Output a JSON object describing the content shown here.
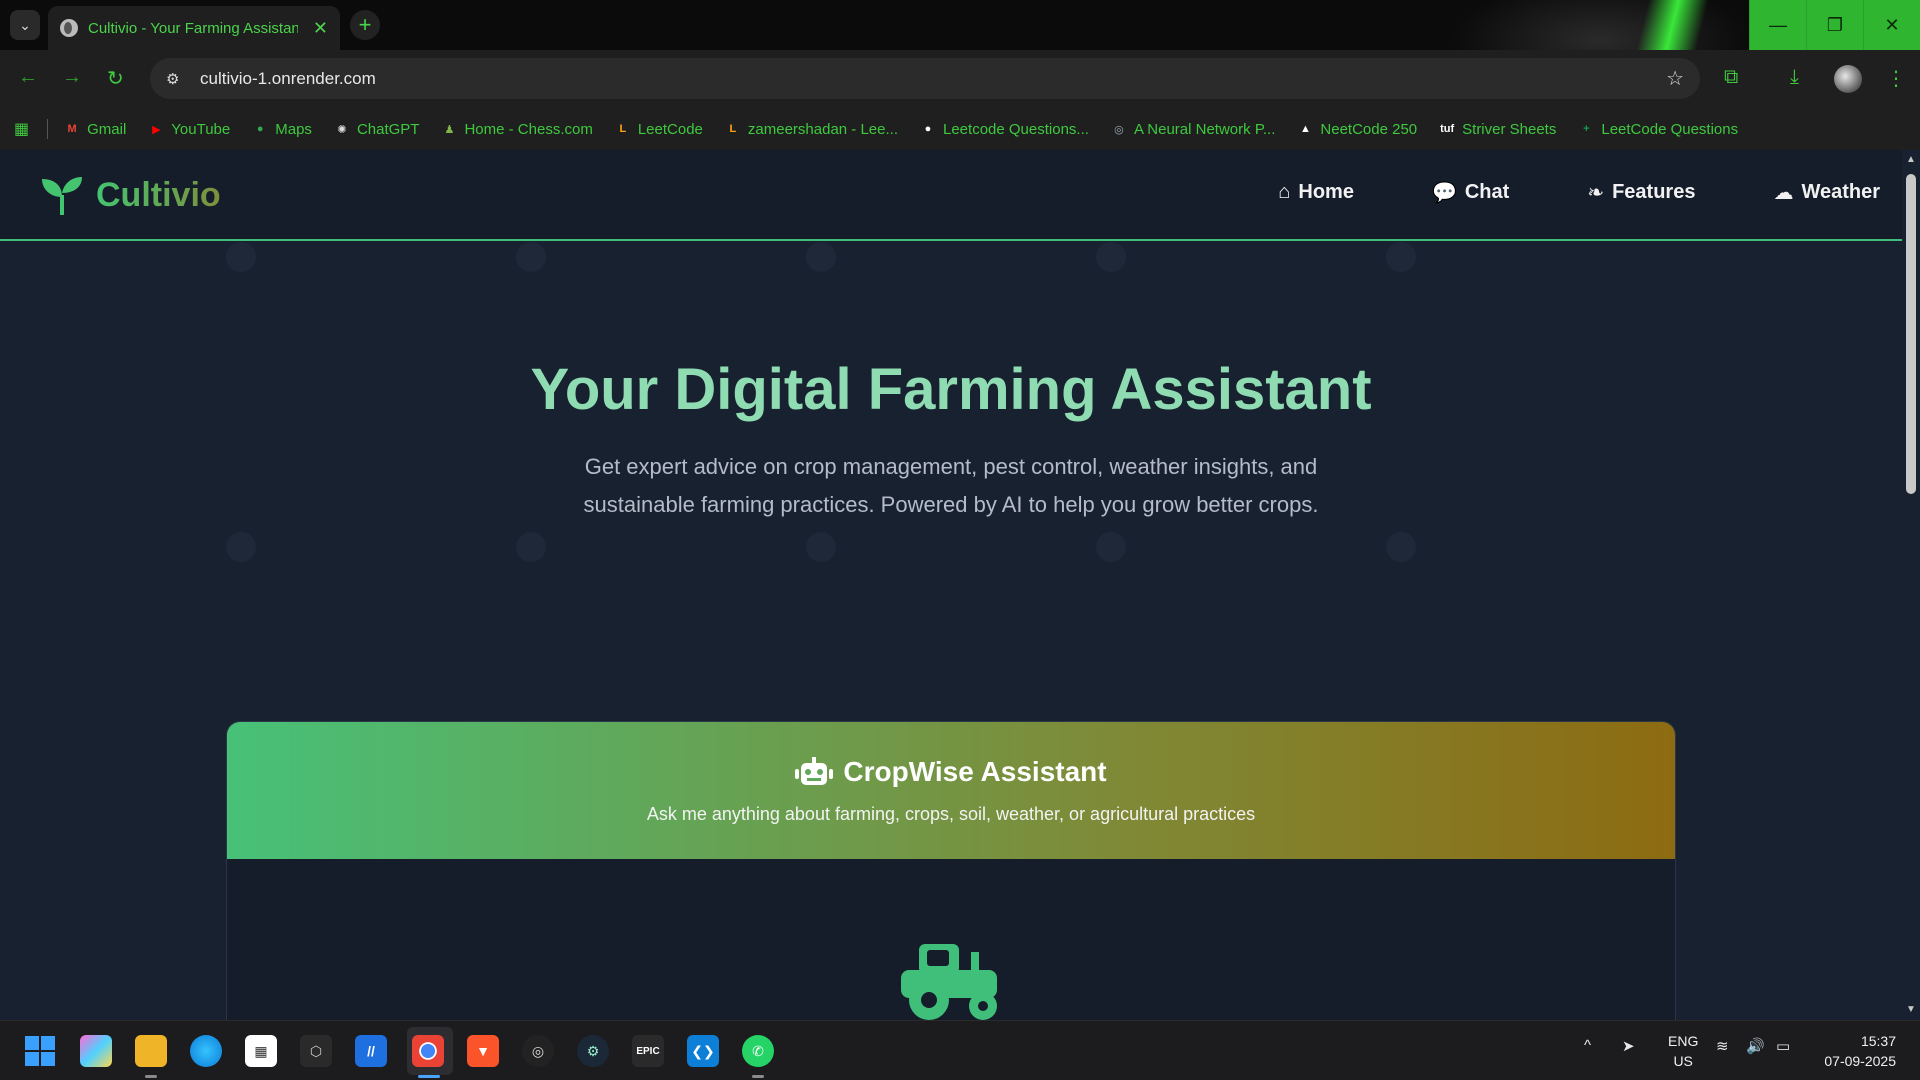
{
  "browser": {
    "tab_title": "Cultivio - Your Farming Assistant",
    "url": "cultivio-1.onrender.com",
    "bookmarks": [
      {
        "label": "Gmail",
        "icon": "M",
        "color": "#ea4335"
      },
      {
        "label": "YouTube",
        "icon": "▶",
        "color": "#ff0000"
      },
      {
        "label": "Maps",
        "icon": "●",
        "color": "#34a853"
      },
      {
        "label": "ChatGPT",
        "icon": "✺",
        "color": "#dddddd"
      },
      {
        "label": "Home - Chess.com",
        "icon": "♟",
        "color": "#81b64c"
      },
      {
        "label": "LeetCode",
        "icon": "L",
        "color": "#ffa116"
      },
      {
        "label": "zameershadan - Lee...",
        "icon": "L",
        "color": "#ffa116"
      },
      {
        "label": "Leetcode Questions...",
        "icon": "●",
        "color": "#ffffff"
      },
      {
        "label": "A Neural Network P...",
        "icon": "◎",
        "color": "#9ab"
      },
      {
        "label": "NeetCode 250",
        "icon": "▲",
        "color": "#ffffff"
      },
      {
        "label": "Striver Sheets",
        "icon": "tuf",
        "color": "#ffffff"
      },
      {
        "label": "LeetCode Questions",
        "icon": "+",
        "color": "#0f9d58"
      }
    ]
  },
  "site": {
    "brand": "Cultivio",
    "nav": [
      {
        "label": "Home",
        "icon": "⌂"
      },
      {
        "label": "Chat",
        "icon": "💬"
      },
      {
        "label": "Features",
        "icon": "❧"
      },
      {
        "label": "Weather",
        "icon": "☁"
      }
    ],
    "hero_title": "Your Digital Farming Assistant",
    "hero_subtitle": "Get expert advice on crop management, pest control, weather insights, and sustainable farming practices. Powered by AI to help you grow better crops.",
    "chat": {
      "title": "CropWise Assistant",
      "subtitle": "Ask me anything about farming, crops, soil, weather, or agricultural practices"
    },
    "colors": {
      "accent": "#3fbf7a",
      "header_grad_end": "#8d6b12"
    }
  },
  "taskbar": {
    "lang_top": "ENG",
    "lang_bottom": "US",
    "time": "15:37",
    "date": "07-09-2025"
  }
}
